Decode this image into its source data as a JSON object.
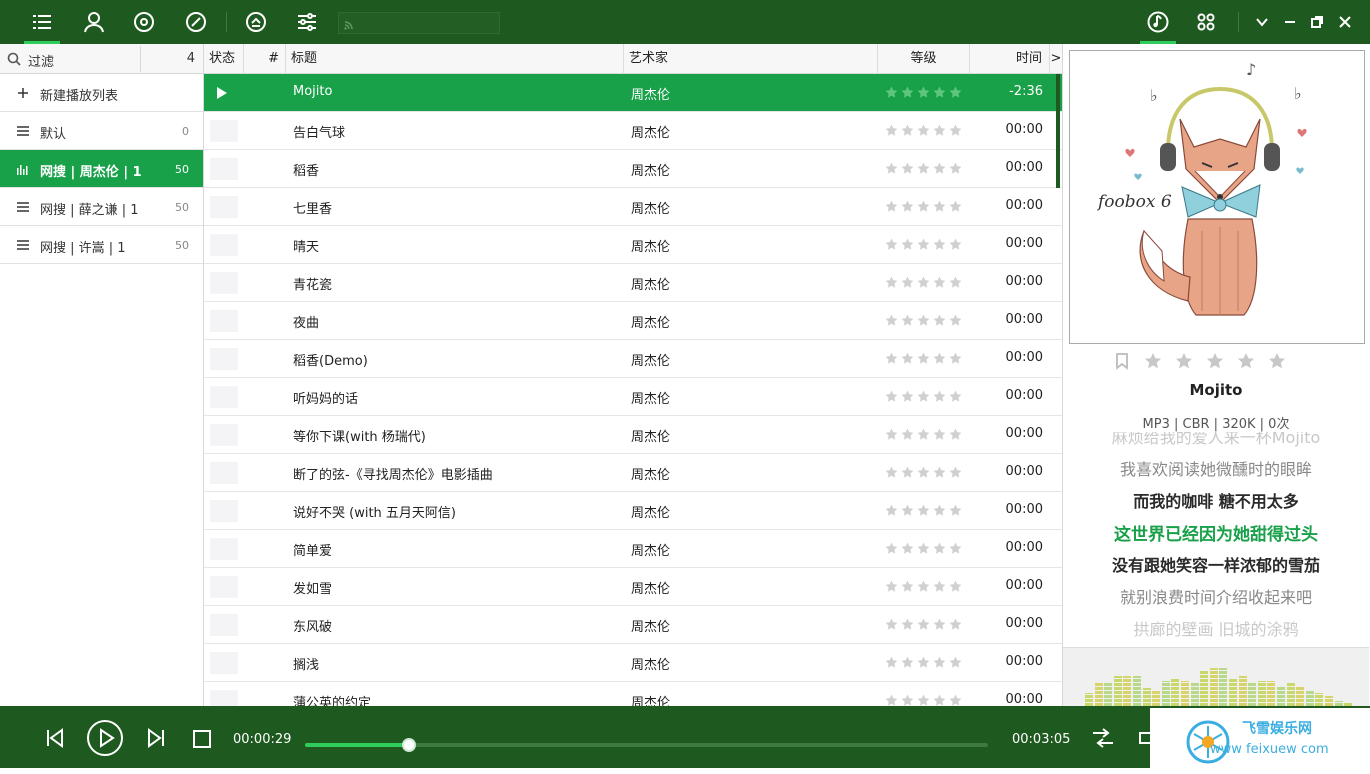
{
  "toolbar": {
    "nav_icons": [
      "playlist-icon",
      "artist-icon",
      "album-icon",
      "disc-icon",
      "eject-icon",
      "equalizer-icon"
    ],
    "rss_icon": "rss-icon",
    "right_icons": [
      "music-note-icon",
      "grid-icon"
    ],
    "window_icons": [
      "chevron-down-icon",
      "minimize-icon",
      "restore-icon",
      "close-icon"
    ]
  },
  "sidebar": {
    "filter_label": "过滤",
    "filter_count": "4",
    "items": [
      {
        "label": "新建播放列表",
        "count": "",
        "icon": "plus-icon"
      },
      {
        "label": "默认",
        "count": "0",
        "icon": "list-icon"
      },
      {
        "label": "网搜 | 周杰伦 | 1",
        "count": "50",
        "icon": "bars-icon",
        "selected": true
      },
      {
        "label": "网搜 | 薛之谦 | 1",
        "count": "50",
        "icon": "list-icon"
      },
      {
        "label": "网搜 | 许嵩 | 1",
        "count": "50",
        "icon": "list-icon"
      }
    ]
  },
  "tracklist": {
    "headers": {
      "status": "状态",
      "num": "#",
      "title": "标题",
      "artist": "艺术家",
      "rating": "等级",
      "time": "时间",
      "more": ">"
    },
    "rows": [
      {
        "title": "Mojito",
        "artist": "周杰伦",
        "time": "-2:36",
        "playing": true
      },
      {
        "title": "告白气球",
        "artist": "周杰伦",
        "time": "00:00"
      },
      {
        "title": "稻香",
        "artist": "周杰伦",
        "time": "00:00"
      },
      {
        "title": "七里香",
        "artist": "周杰伦",
        "time": "00:00"
      },
      {
        "title": "晴天",
        "artist": "周杰伦",
        "time": "00:00"
      },
      {
        "title": "青花瓷",
        "artist": "周杰伦",
        "time": "00:00"
      },
      {
        "title": "夜曲",
        "artist": "周杰伦",
        "time": "00:00"
      },
      {
        "title": "稻香(Demo)",
        "artist": "周杰伦",
        "time": "00:00"
      },
      {
        "title": "听妈妈的话",
        "artist": "周杰伦",
        "time": "00:00"
      },
      {
        "title": "等你下课(with 杨瑞代)",
        "artist": "周杰伦",
        "time": "00:00"
      },
      {
        "title": "断了的弦-《寻找周杰伦》电影插曲",
        "artist": "周杰伦",
        "time": "00:00"
      },
      {
        "title": "说好不哭 (with 五月天阿信)",
        "artist": "周杰伦",
        "time": "00:00"
      },
      {
        "title": "简单爱",
        "artist": "周杰伦",
        "time": "00:00"
      },
      {
        "title": "发如雪",
        "artist": "周杰伦",
        "time": "00:00"
      },
      {
        "title": "东风破",
        "artist": "周杰伦",
        "time": "00:00"
      },
      {
        "title": "搁浅",
        "artist": "周杰伦",
        "time": "00:00"
      },
      {
        "title": "蒲公英的约定",
        "artist": "周杰伦",
        "time": "00:00"
      }
    ]
  },
  "now_playing": {
    "album_art_text": "foobox 6",
    "title": "Mojito",
    "info": "MP3 | CBR | 320K | 0次",
    "lyrics": [
      {
        "text": "麻烦给我的爱人来一杯Mojito",
        "style": "fade"
      },
      {
        "text": "我喜欢阅读她微醺时的眼眸",
        "style": "dim"
      },
      {
        "text": "而我的咖啡 糖不用太多",
        "style": "near"
      },
      {
        "text": "这世界已经因为她甜得过头",
        "style": "current"
      },
      {
        "text": "没有跟她笑容一样浓郁的雪茄",
        "style": "near"
      },
      {
        "text": "就别浪费时间介绍收起来吧",
        "style": "dim"
      },
      {
        "text": "拱廊的壁画 旧城的涂鸦",
        "style": "fade"
      }
    ],
    "spectrum": [
      0.25,
      0.45,
      0.45,
      0.6,
      0.6,
      0.6,
      0.35,
      0.3,
      0.5,
      0.55,
      0.5,
      0.45,
      0.7,
      0.75,
      0.75,
      0.55,
      0.6,
      0.45,
      0.5,
      0.5,
      0.4,
      0.45,
      0.4,
      0.3,
      0.25,
      0.2,
      0.1,
      0.05
    ]
  },
  "player": {
    "elapsed": "00:00:29",
    "total": "00:03:05",
    "progress": 0.153,
    "accent": "#2ecc5a"
  },
  "watermark": {
    "line1": "飞雪娱乐网",
    "line2": "www   feixuew   com"
  }
}
